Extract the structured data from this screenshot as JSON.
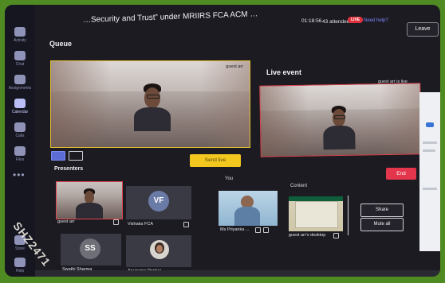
{
  "app": {
    "title": "…Security and Trust” under MRIIRS FCA ACM …",
    "timer": "01:18:56",
    "attendees": "43 attendees",
    "live_badge": "LIVE",
    "need_help": "Need help?",
    "leave_label": "Leave"
  },
  "rail": {
    "items": [
      {
        "label": "Activity",
        "icon": "bell-icon"
      },
      {
        "label": "Chat",
        "icon": "chat-icon"
      },
      {
        "label": "Assignments",
        "icon": "assignments-icon"
      },
      {
        "label": "Calendar",
        "icon": "calendar-icon"
      },
      {
        "label": "Calls",
        "icon": "phone-icon"
      },
      {
        "label": "Files",
        "icon": "file-icon"
      },
      {
        "label": "Store",
        "icon": "apps-icon"
      },
      {
        "label": "Help",
        "icon": "help-icon"
      }
    ]
  },
  "queue": {
    "title": "Queue",
    "tile_label": "guest arr",
    "send_live_label": "Send live"
  },
  "live_event": {
    "title": "Live event",
    "tile_label": "guest arr is live",
    "end_label": "End"
  },
  "presenters": {
    "title": "Presenters",
    "tiles": [
      {
        "name": "guest arr",
        "initials": "",
        "type": "video"
      },
      {
        "name": "Vishaka FCA",
        "initials": "VF",
        "type": "avatar",
        "color": "#6b7ba8"
      },
      {
        "name": "Swathi Sharma",
        "initials": "SS",
        "type": "avatar",
        "color": "#6f6f78"
      },
      {
        "name": "Anupama Pankaj",
        "initials": "",
        "type": "photo"
      }
    ]
  },
  "you": {
    "title": "You",
    "name": "Ms Priyanka ..."
  },
  "content": {
    "title": "Content",
    "name": "guest arr's desktop"
  },
  "side_buttons": {
    "share": "Share",
    "mute_all": "Mute all"
  },
  "watermark": "SHZ2471"
}
